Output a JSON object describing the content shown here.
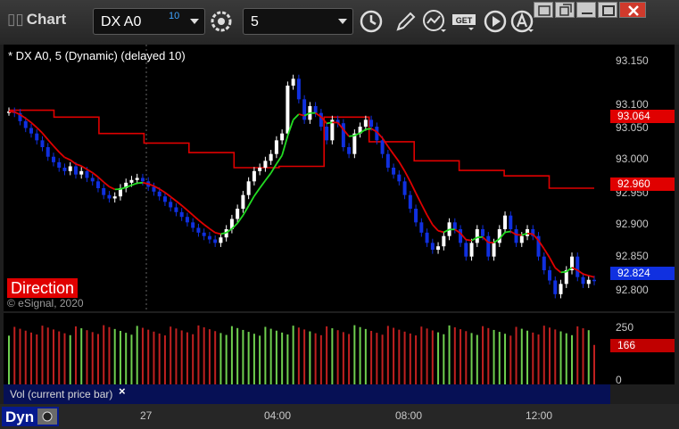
{
  "window": {
    "title": "Chart",
    "symbol": "DX A0",
    "delay_badge": "10",
    "interval": "5"
  },
  "toolbar": {
    "icons": [
      "settings-gear-icon",
      "clock-icon",
      "pencil-draw-icon",
      "studies-icon",
      "get-data-icon",
      "play-icon",
      "alert-icon"
    ]
  },
  "window_controls": [
    "link-icon",
    "restore-icon",
    "minimize-icon",
    "maximize-icon",
    "close-icon"
  ],
  "chart": {
    "study_label": "* DX A0, 5 (Dynamic) (delayed 10)",
    "direction_label": "Direction",
    "copyright": "© eSignal, 2020",
    "price_ticks": [
      "93.150",
      "93.100",
      "93.050",
      "93.000",
      "92.950",
      "92.900",
      "92.850",
      "92.800"
    ],
    "flags": {
      "upper": "93.064",
      "lower": "92.960",
      "last": "92.824"
    },
    "colors": {
      "upper_flag": "#e00000",
      "lower_flag": "#e00000",
      "last_flag": "#1030e0",
      "candle_up": "#ffffff",
      "candle_down": "#1030e0",
      "trail_line": "#e00000",
      "ema_down": "#e00000",
      "ema_up": "#22dd22"
    }
  },
  "volume": {
    "label": "Vol (current price bar)",
    "close_glyph": "×",
    "ticks": [
      "250",
      "0"
    ],
    "current_flag": "166",
    "colors": {
      "up": "#6fcf4f",
      "down": "#c02020"
    }
  },
  "time_axis": {
    "dyn_label": "Dyn",
    "labels": [
      "27",
      "04:00",
      "08:00",
      "12:00"
    ]
  },
  "chart_data": {
    "type": "candlestick",
    "series": "DX A0 5-minute",
    "ylim": [
      92.78,
      93.17
    ],
    "closes": [
      93.072,
      93.07,
      93.058,
      93.048,
      93.04,
      93.03,
      93.02,
      93.006,
      92.998,
      92.99,
      92.985,
      92.992,
      92.98,
      92.985,
      92.975,
      92.97,
      92.96,
      92.95,
      92.945,
      92.948,
      92.96,
      92.968,
      92.972,
      92.975,
      92.97,
      92.962,
      92.955,
      92.948,
      92.94,
      92.932,
      92.925,
      92.918,
      92.91,
      92.902,
      92.895,
      92.89,
      92.885,
      92.88,
      92.888,
      92.9,
      92.915,
      92.93,
      92.95,
      92.97,
      92.985,
      92.99,
      93.0,
      93.01,
      93.03,
      93.04,
      93.11,
      93.12,
      93.09,
      93.06,
      93.08,
      93.07,
      93.05,
      93.03,
      93.06,
      93.055,
      93.02,
      93.01,
      93.04,
      93.05,
      93.06,
      93.05,
      93.03,
      93.01,
      92.99,
      92.98,
      92.97,
      92.95,
      92.93,
      92.91,
      92.895,
      92.88,
      92.87,
      92.875,
      92.89,
      92.91,
      92.9,
      92.88,
      92.86,
      92.88,
      92.9,
      92.89,
      92.86,
      92.88,
      92.9,
      92.92,
      92.9,
      92.88,
      92.89,
      92.9,
      92.89,
      92.86,
      92.84,
      92.825,
      92.805,
      92.82,
      92.84,
      92.86,
      92.83,
      92.82,
      92.826,
      92.824
    ],
    "trail_line_levels": [
      93.074,
      93.064,
      93.04,
      93.026,
      93.012,
      92.99,
      92.992,
      93.064,
      93.028,
      93.0,
      92.986,
      92.978,
      92.96
    ],
    "volume_ylim": [
      0,
      300
    ],
    "volume_last": 166
  }
}
